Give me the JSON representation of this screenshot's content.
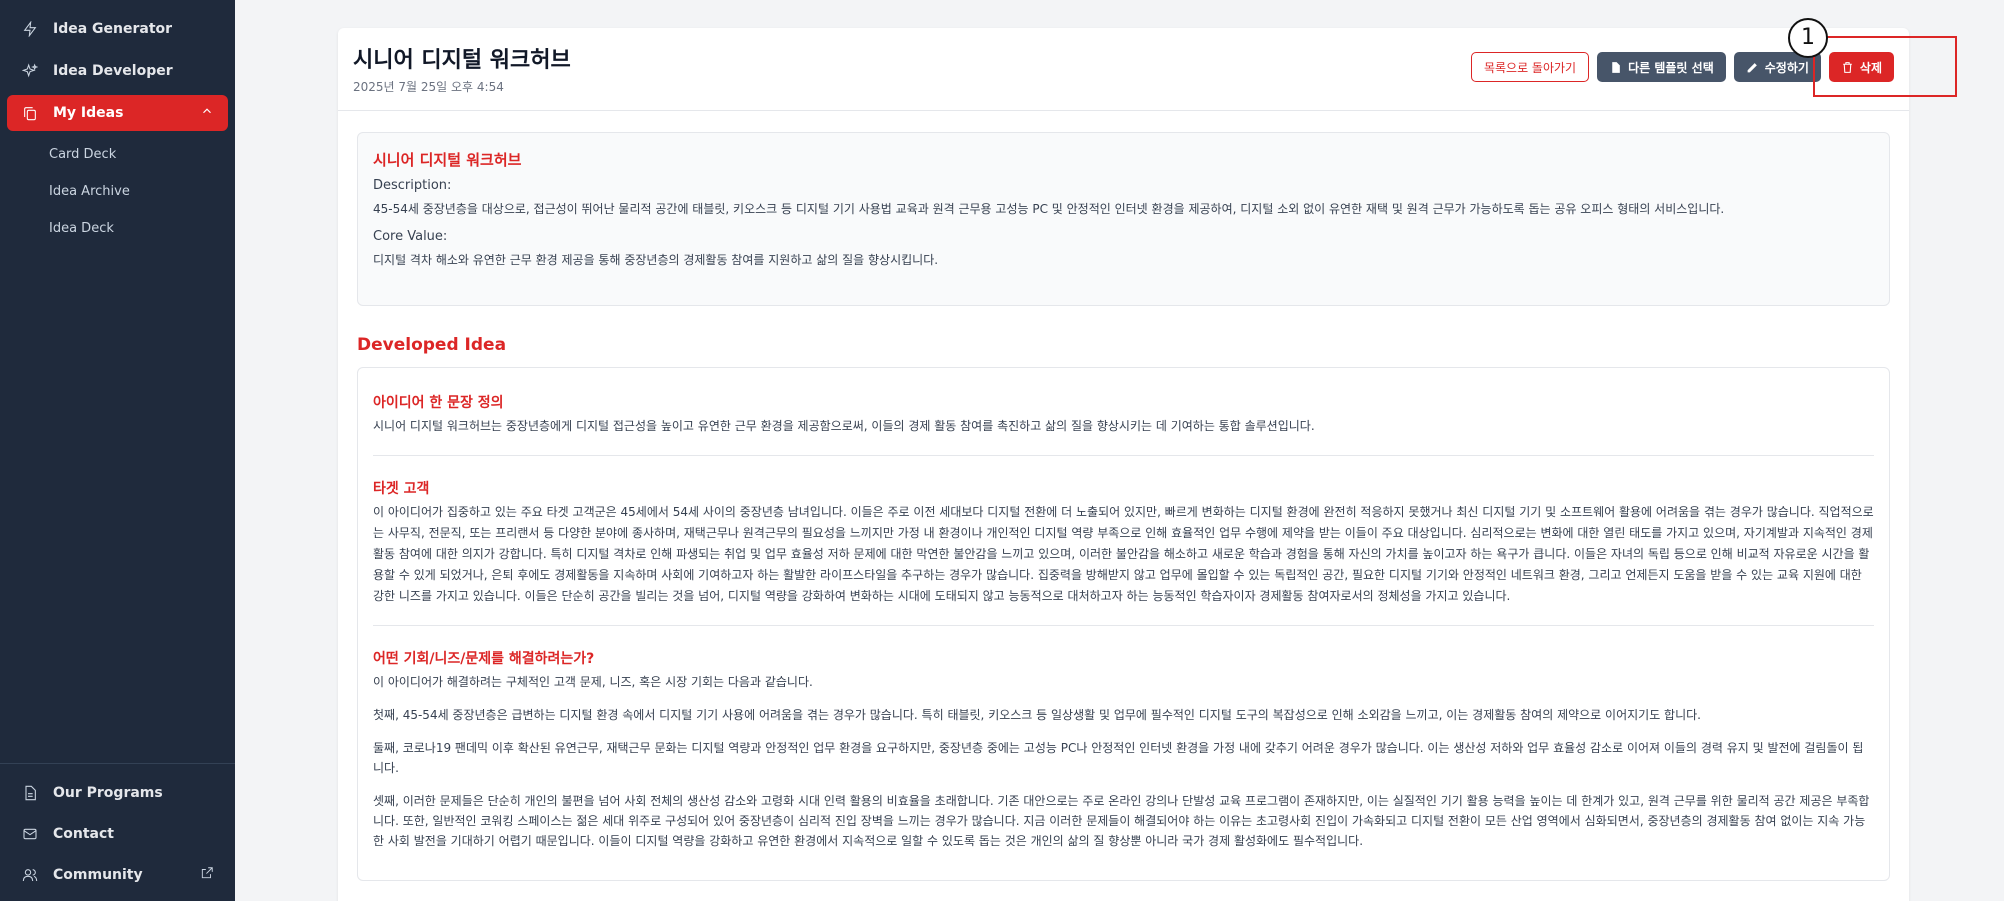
{
  "sidebar": {
    "top_items": [
      {
        "label": "Idea Generator",
        "icon": "zap-icon"
      },
      {
        "label": "Idea Developer",
        "icon": "sparkles-icon"
      },
      {
        "label": "My Ideas",
        "icon": "copy-icon"
      }
    ],
    "sub_items": [
      "Card Deck",
      "Idea Archive",
      "Idea Deck"
    ],
    "bottom_items": [
      {
        "label": "Our Programs",
        "icon": "document-icon"
      },
      {
        "label": "Contact",
        "icon": "mail-icon"
      },
      {
        "label": "Community",
        "icon": "users-icon"
      }
    ]
  },
  "header": {
    "title": "시니어 디지털 워크허브",
    "date": "2025년 7월 25일 오후 4:54",
    "buttons": {
      "back": "목록으로 돌아가기",
      "template": "다른 템플릿 선택",
      "edit": "수정하기",
      "delete": "삭제"
    },
    "marker": "1"
  },
  "summary": {
    "title": "시니어 디지털 워크허브",
    "description_label": "Description:",
    "description": "45-54세 중장년층을 대상으로, 접근성이 뛰어난 물리적 공간에 태블릿, 키오스크 등 디지털 기기 사용법 교육과 원격 근무용 고성능 PC 및 안정적인 인터넷 환경을 제공하여, 디지털 소외 없이 유연한 재택 및 원격 근무가 가능하도록 돕는 공유 오피스 형태의 서비스입니다.",
    "core_value_label": "Core Value:",
    "core_value": "디지털 격차 해소와 유연한 근무 환경 제공을 통해 중장년층의 경제활동 참여를 지원하고 삶의 질을 향상시킵니다."
  },
  "developed": {
    "heading": "Developed Idea",
    "sections": [
      {
        "title": "아이디어 한 문장 정의",
        "paragraphs": [
          "시니어 디지털 워크허브는 중장년층에게 디지털 접근성을 높이고 유연한 근무 환경을 제공함으로써, 이들의 경제 활동 참여를 촉진하고 삶의 질을 향상시키는 데 기여하는 통합 솔루션입니다."
        ]
      },
      {
        "title": "타겟 고객",
        "paragraphs": [
          "이 아이디어가 집중하고 있는 주요 타겟 고객군은 45세에서 54세 사이의 중장년층 남녀입니다. 이들은 주로 이전 세대보다 디지털 전환에 더 노출되어 있지만, 빠르게 변화하는 디지털 환경에 완전히 적응하지 못했거나 최신 디지털 기기 및 소프트웨어 활용에 어려움을 겪는 경우가 많습니다. 직업적으로는 사무직, 전문직, 또는 프리랜서 등 다양한 분야에 종사하며, 재택근무나 원격근무의 필요성을 느끼지만 가정 내 환경이나 개인적인 디지털 역량 부족으로 인해 효율적인 업무 수행에 제약을 받는 이들이 주요 대상입니다. 심리적으로는 변화에 대한 열린 태도를 가지고 있으며, 자기계발과 지속적인 경제활동 참여에 대한 의지가 강합니다. 특히 디지털 격차로 인해 파생되는 취업 및 업무 효율성 저하 문제에 대한 막연한 불안감을 느끼고 있으며, 이러한 불안감을 해소하고 새로운 학습과 경험을 통해 자신의 가치를 높이고자 하는 욕구가 큽니다. 이들은 자녀의 독립 등으로 인해 비교적 자유로운 시간을 활용할 수 있게 되었거나, 은퇴 후에도 경제활동을 지속하며 사회에 기여하고자 하는 활발한 라이프스타일을 추구하는 경우가 많습니다. 집중력을 방해받지 않고 업무에 몰입할 수 있는 독립적인 공간, 필요한 디지털 기기와 안정적인 네트워크 환경, 그리고 언제든지 도움을 받을 수 있는 교육 지원에 대한 강한 니즈를 가지고 있습니다. 이들은 단순히 공간을 빌리는 것을 넘어, 디지털 역량을 강화하여 변화하는 시대에 도태되지 않고 능동적으로 대처하고자 하는 능동적인 학습자이자 경제활동 참여자로서의 정체성을 가지고 있습니다."
        ]
      },
      {
        "title": "어떤 기회/니즈/문제를 해결하려는가?",
        "paragraphs": [
          "이 아이디어가 해결하려는 구체적인 고객 문제, 니즈, 혹은 시장 기회는 다음과 같습니다.",
          "첫째, 45-54세 중장년층은 급변하는 디지털 환경 속에서 디지털 기기 사용에 어려움을 겪는 경우가 많습니다. 특히 태블릿, 키오스크 등 일상생활 및 업무에 필수적인 디지털 도구의 복잡성으로 인해 소외감을 느끼고, 이는 경제활동 참여의 제약으로 이어지기도 합니다.",
          "둘째, 코로나19 팬데믹 이후 확산된 유연근무, 재택근무 문화는 디지털 역량과 안정적인 업무 환경을 요구하지만, 중장년층 중에는 고성능 PC나 안정적인 인터넷 환경을 가정 내에 갖추기 어려운 경우가 많습니다. 이는 생산성 저하와 업무 효율성 감소로 이어져 이들의 경력 유지 및 발전에 걸림돌이 됩니다.",
          "셋째, 이러한 문제들은 단순히 개인의 불편을 넘어 사회 전체의 생산성 감소와 고령화 시대 인력 활용의 비효율을 초래합니다. 기존 대안으로는 주로 온라인 강의나 단발성 교육 프로그램이 존재하지만, 이는 실질적인 기기 활용 능력을 높이는 데 한계가 있고, 원격 근무를 위한 물리적 공간 제공은 부족합니다. 또한, 일반적인 코워킹 스페이스는 젊은 세대 위주로 구성되어 있어 중장년층이 심리적 진입 장벽을 느끼는 경우가 많습니다. 지금 이러한 문제들이 해결되어야 하는 이유는 초고령사회 진입이 가속화되고 디지털 전환이 모든 산업 영역에서 심화되면서, 중장년층의 경제활동 참여 없이는 지속 가능한 사회 발전을 기대하기 어렵기 때문입니다. 이들이 디지털 역량을 강화하고 유연한 환경에서 지속적으로 일할 수 있도록 돕는 것은 개인의 삶의 질 향상뿐 아니라 국가 경제 활성화에도 필수적입니다."
        ]
      }
    ]
  }
}
